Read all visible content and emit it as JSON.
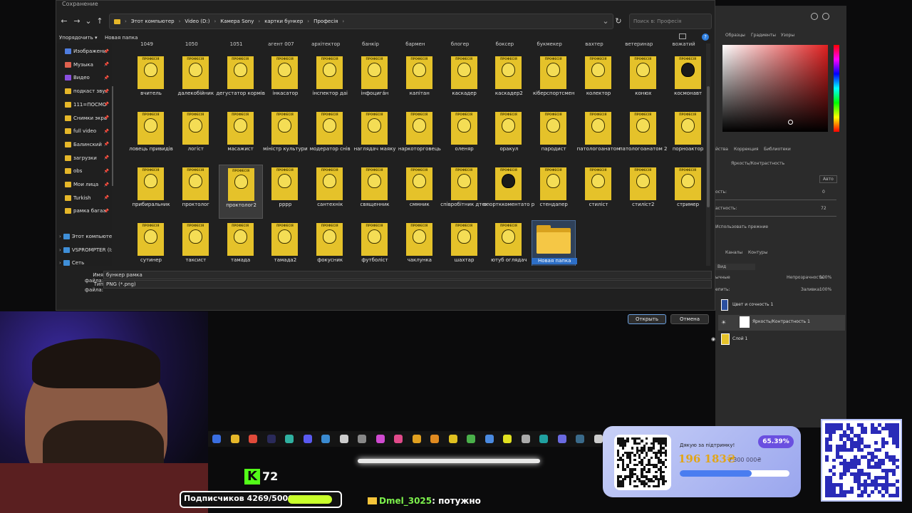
{
  "dialog": {
    "title": "Сохранение",
    "path": [
      "Этот компьютер",
      "Video (D:)",
      "Камера Sony",
      "картки бункер",
      "Професія"
    ],
    "search_placeholder": "Поиск в: Професія",
    "toolbar": {
      "organize": "Упорядочить ▾",
      "new_folder": "Новая папка"
    },
    "sidebar": [
      {
        "label": "Изображени",
        "color": "#4f7de0"
      },
      {
        "label": "Музыка",
        "color": "#e0614f"
      },
      {
        "label": "Видео",
        "color": "#8a4fe0"
      },
      {
        "label": "подкаст звук",
        "color": "#e6b729"
      },
      {
        "label": "111=ПОСМО",
        "color": "#e6b729"
      },
      {
        "label": "Снимки экра",
        "color": "#e6b729"
      },
      {
        "label": "full video",
        "color": "#e6b729"
      },
      {
        "label": "Балинский",
        "color": "#e6b729"
      },
      {
        "label": "загрузки",
        "color": "#e6b729"
      },
      {
        "label": "obs",
        "color": "#e6b729"
      },
      {
        "label": "Мои лица",
        "color": "#e6b729"
      },
      {
        "label": "Turkish",
        "color": "#e6b729"
      },
      {
        "label": "рамка багаж",
        "color": "#e6b729"
      }
    ],
    "sidebar_bottom": [
      "Этот компьютер",
      "VSPROMPTER (I:",
      "Сеть"
    ],
    "top_row": [
      "1049",
      "1050",
      "1051",
      "агент 007",
      "архітектор",
      "банкір",
      "бармен",
      "блогер",
      "боксер",
      "букмекер",
      "вахтер",
      "ветеринар",
      "вожатий"
    ],
    "card_label": "ПРОФЕСІЯ",
    "files": [
      [
        "вчитель",
        "далекобійник",
        "дегустатор кормів",
        "інкасатор",
        "інспектор даі",
        "інфоцига́н",
        "капітан",
        "каскадер",
        "каскадер2",
        "кіберспортсмен",
        "колектор",
        "конюх",
        "космонавт"
      ],
      [
        "ловець привидів",
        "логіст",
        "масажист",
        "міністр культури",
        "модератор снів",
        "наглядач маяку",
        "наркоторговець",
        "оленяр",
        "оракул",
        "пародист",
        "патологоанатом",
        "патологоанатом 2",
        "порноактор"
      ],
      [
        "прибиральник",
        "проктолог",
        "проктолог2",
        "рррр",
        "сантехнік",
        "священник",
        "сммник",
        "співробітник дтек",
        "спортккоментато р",
        "стендапер",
        "стиліст",
        "стиліст2",
        "стример"
      ],
      [
        "сутинер",
        "таксист",
        "тамада",
        "тамада2",
        "фокусник",
        "футболіст",
        "чаклунка",
        "шахтар",
        "ютуб оглядач"
      ]
    ],
    "new_folder_name": "Новая папка",
    "filename_label": "Имя файла:",
    "filename_value": "бункер рамка",
    "filetype_label": "Тип файла:",
    "filetype_value": "PNG (*.png)",
    "open_button": "Открыть",
    "cancel_button": "Отмена"
  },
  "photoshop": {
    "tabs_top": [
      "Образцы",
      "Градиенты",
      "Узоры"
    ],
    "tabs_mid": [
      "йства",
      "Коррекция",
      "Библиотеки"
    ],
    "adjustment": "Яркость/Контрастность",
    "auto": "Авто",
    "brightness_label": "ость:",
    "brightness_value": "0",
    "contrast_label": "астность:",
    "contrast_value": "72",
    "legacy": "Использовать прежние",
    "layer_tabs": [
      "Каналы",
      "Контуры"
    ],
    "kind": "Вид",
    "blend": "ычные",
    "opacity_label": "Непрозрачность:",
    "opacity_value": "100%",
    "fill_label": "Заливка:",
    "fill_value": "100%",
    "lock_label": "епить:",
    "layers": [
      "Цвет и сочность 1",
      "Яркость/Контрастность 1",
      "Слой 1"
    ]
  },
  "stream": {
    "kick_count": "72",
    "subs": "Подписчиков 4269/5000",
    "chat_user": "Dmel_3025",
    "chat_text": ": потужно",
    "donation_title": "Дякую за підтримку!",
    "donation_percent": "65.39%",
    "donation_amount": "196 183₴",
    "donation_goal": "/ 300 000₴",
    "donation_progress": 0.6539
  }
}
